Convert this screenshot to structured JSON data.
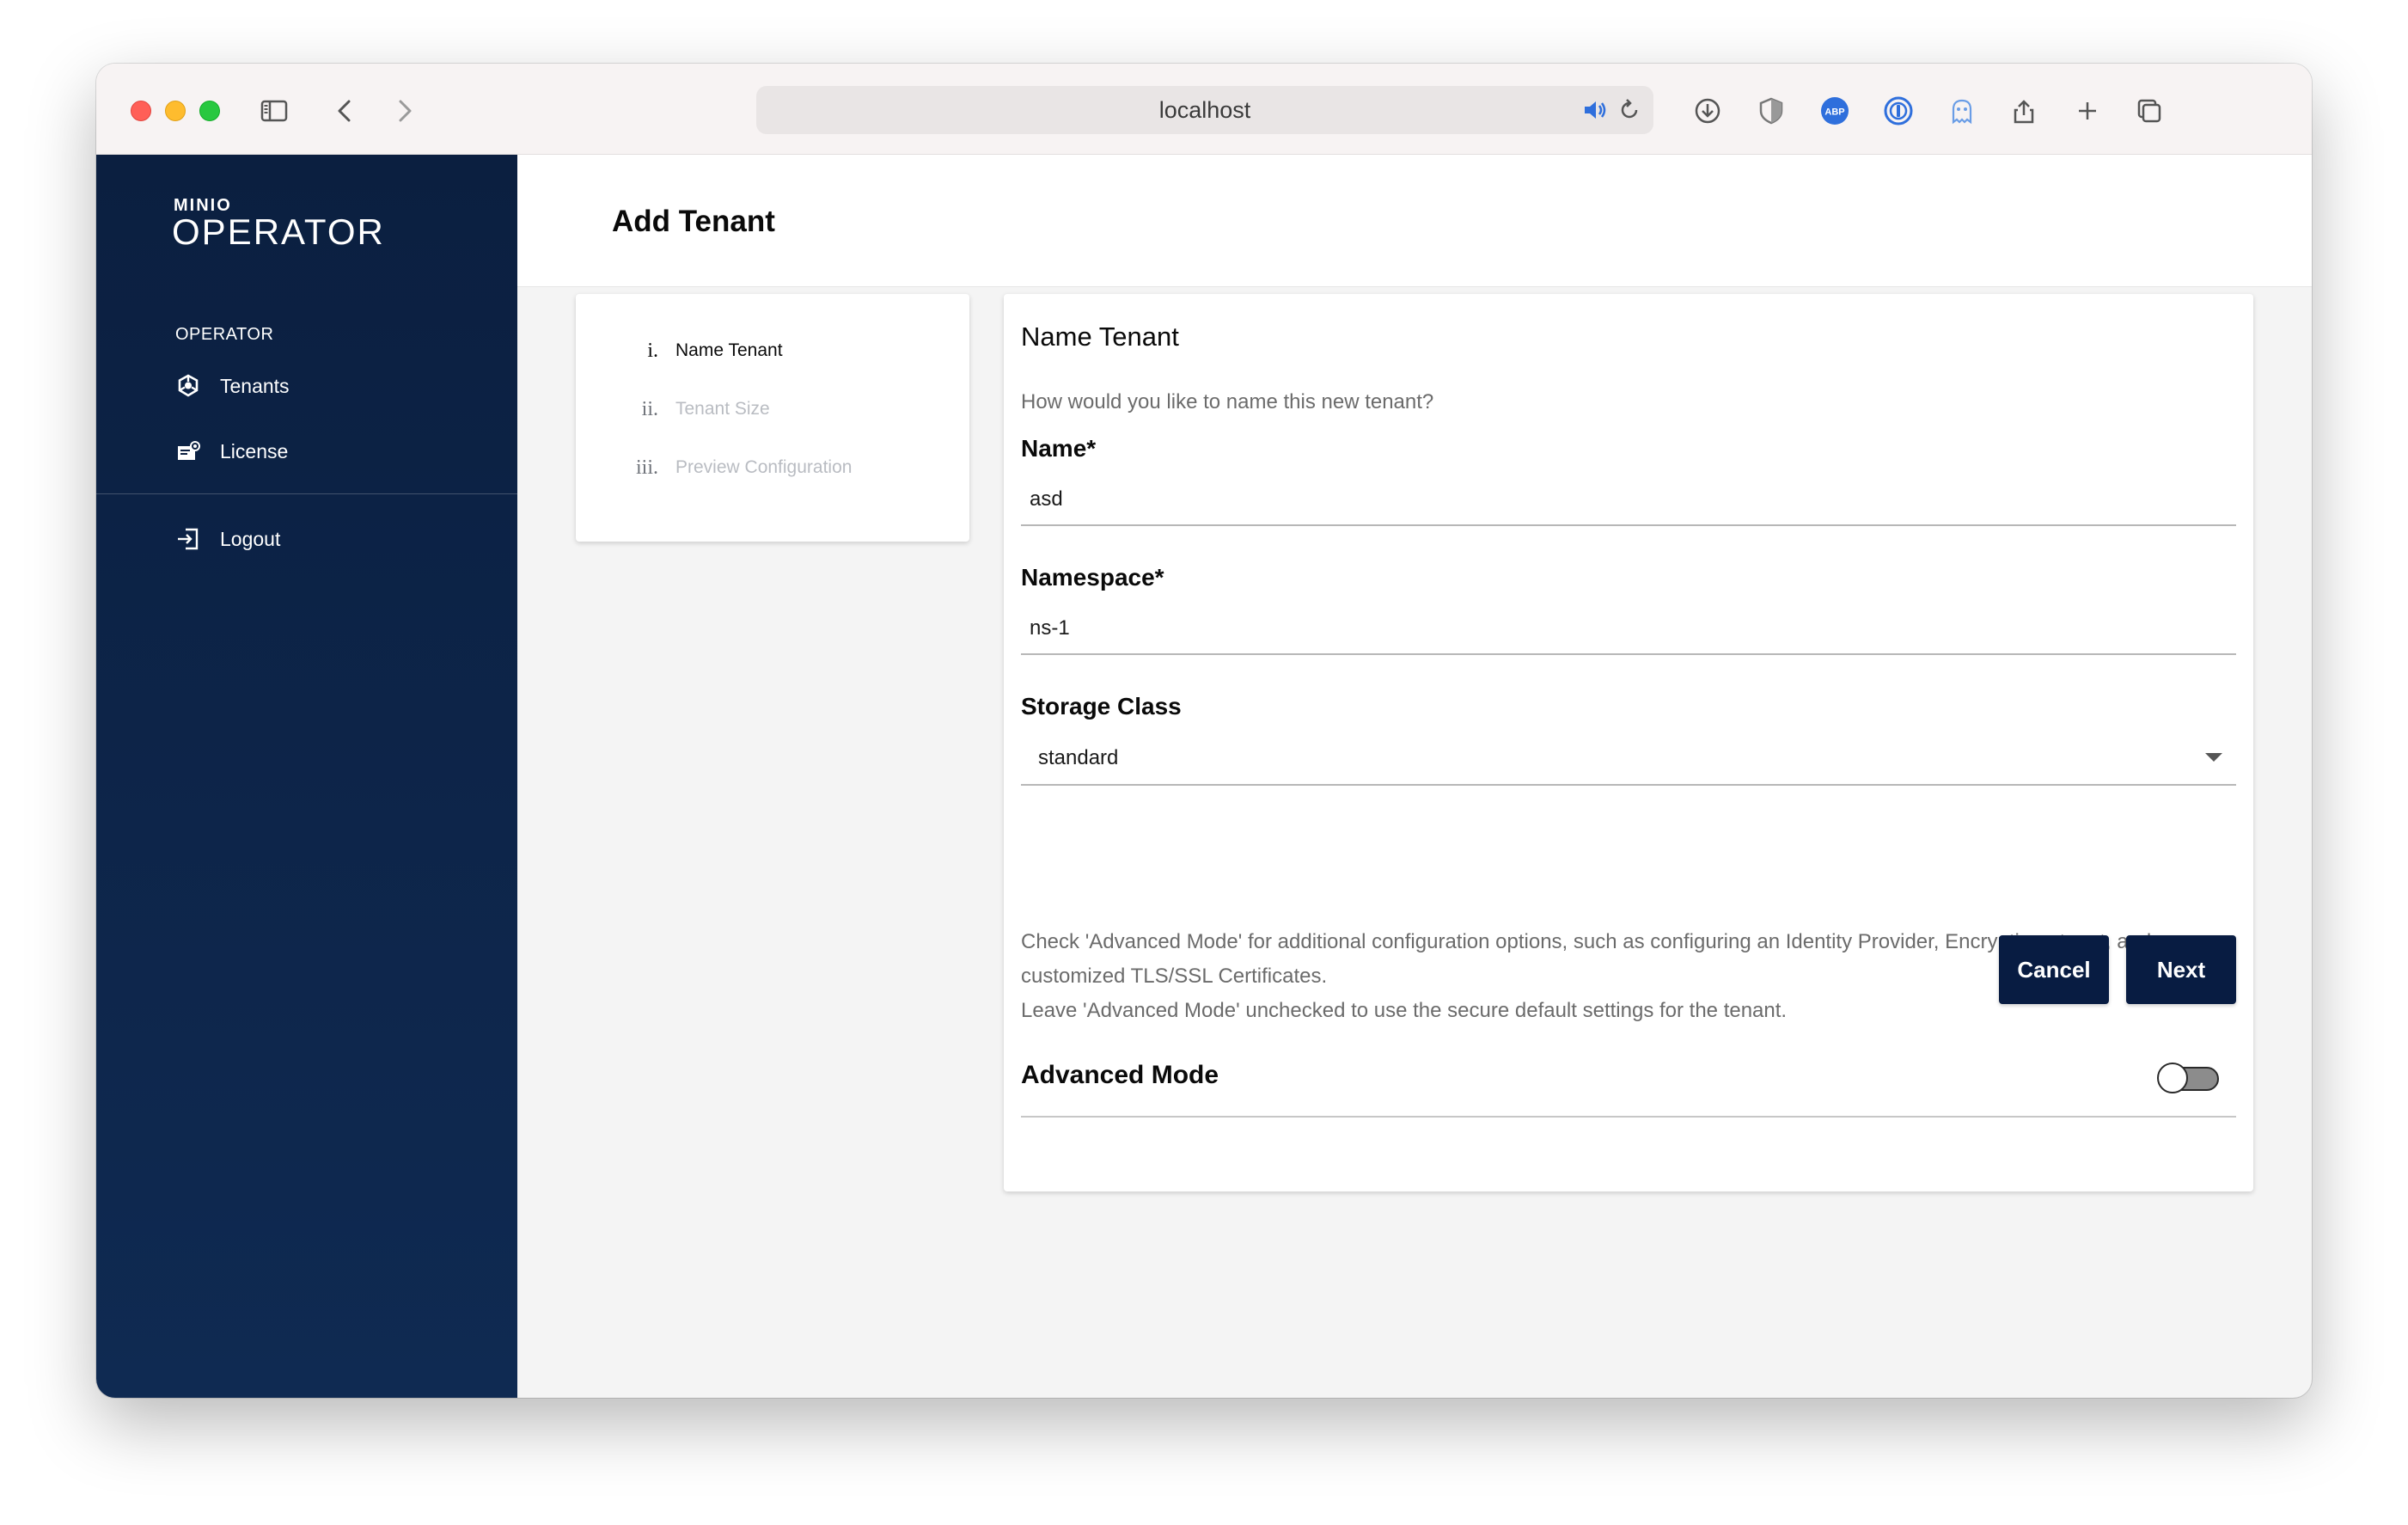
{
  "browser": {
    "address": "localhost",
    "extension_abp": "ABP"
  },
  "sidebar": {
    "logo_small": "MINIO",
    "logo_big": "OPERATOR",
    "section": "OPERATOR",
    "items": [
      {
        "label": "Tenants",
        "icon": "tenants-icon"
      },
      {
        "label": "License",
        "icon": "license-icon"
      },
      {
        "label": "Logout",
        "icon": "logout-icon"
      }
    ]
  },
  "header": {
    "title": "Add Tenant"
  },
  "steps": [
    {
      "num": "i.",
      "label": "Name Tenant",
      "active": true
    },
    {
      "num": "ii.",
      "label": "Tenant Size",
      "active": false
    },
    {
      "num": "iii.",
      "label": "Preview Configuration",
      "active": false
    }
  ],
  "form": {
    "title": "Name Tenant",
    "subtitle": "How would you like to name this new tenant?",
    "name_label": "Name*",
    "name_value": "asd",
    "namespace_label": "Namespace*",
    "namespace_value": "ns-1",
    "storage_label": "Storage Class",
    "storage_value": "standard",
    "info_line1": "Check 'Advanced Mode' for additional configuration options, such as configuring an Identity Provider, Encryption at rest, and customized TLS/SSL Certificates.",
    "info_line2": "Leave 'Advanced Mode' unchecked to use the secure default settings for the tenant.",
    "advanced_label": "Advanced Mode",
    "advanced_enabled": false,
    "cancel_label": "Cancel",
    "next_label": "Next"
  },
  "colors": {
    "sidebar_bg": "#0b1f40",
    "button_bg": "#081c42",
    "page_bg": "#f4f4f4"
  }
}
